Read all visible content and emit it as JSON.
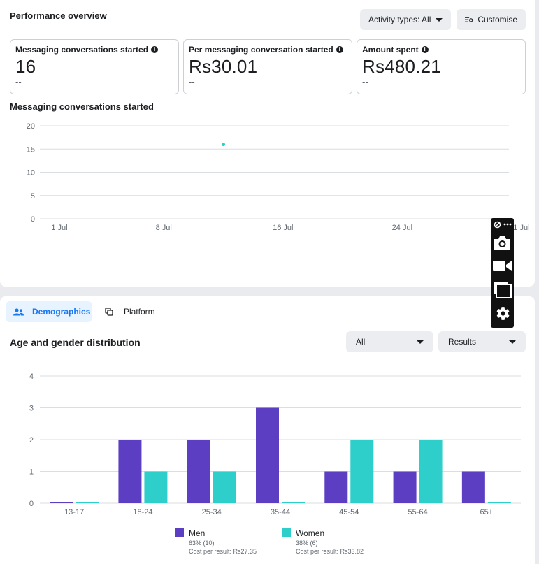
{
  "performance": {
    "title": "Performance overview",
    "activity_label": "Activity types: All",
    "customise_label": "Customise",
    "metrics": [
      {
        "label": "Messaging conversations started",
        "value": "16",
        "sub": "--"
      },
      {
        "label": "Per messaging conversation started",
        "value": "Rs30.01",
        "sub": "--"
      },
      {
        "label": "Amount spent",
        "value": "Rs480.21",
        "sub": "--"
      }
    ]
  },
  "line_chart": {
    "title": "Messaging conversations started",
    "y_ticks": [
      "20",
      "15",
      "10",
      "5",
      "0"
    ],
    "x_ticks": [
      "1 Jul",
      "8 Jul",
      "16 Jul",
      "24 Jul",
      "1 Jul"
    ]
  },
  "tabs": {
    "demographics": "Demographics",
    "platform": "Platform"
  },
  "demographics": {
    "title": "Age and gender distribution",
    "filter_all": "All",
    "filter_results": "Results"
  },
  "legend": {
    "men_label": "Men",
    "men_pct": "63% (10)",
    "men_cost": "Cost per result: Rs27.35",
    "women_label": "Women",
    "women_pct": "38% (6)",
    "women_cost": "Cost per result: Rs33.82"
  },
  "colors": {
    "men": "#5c3ec2",
    "women": "#2ecfcb",
    "accent": "#1877f2",
    "tab_active_bg": "#e7f3ff"
  },
  "icons": [
    "info-icon",
    "caret-down-icon",
    "filter-settings-icon",
    "people-icon",
    "platform-icon",
    "pin-icon",
    "more-icon",
    "camera-icon",
    "video-icon",
    "windows-icon",
    "gear-icon"
  ],
  "chart_data": [
    {
      "type": "scatter",
      "title": "Messaging conversations started",
      "x_ticks": [
        "1 Jul",
        "8 Jul",
        "16 Jul",
        "24 Jul",
        "1 Jul"
      ],
      "ylim": [
        0,
        20
      ],
      "y_ticks": [
        0,
        5,
        10,
        15,
        20
      ],
      "grid": true,
      "series": [
        {
          "points": [
            {
              "x": "12 Jul",
              "y": 16
            }
          ]
        }
      ]
    },
    {
      "type": "bar",
      "title": "Age and gender distribution",
      "categories": [
        "13-17",
        "18-24",
        "25-34",
        "35-44",
        "45-54",
        "55-64",
        "65+"
      ],
      "ylim": [
        0,
        4
      ],
      "y_ticks": [
        0,
        1,
        2,
        3,
        4
      ],
      "grid": true,
      "legend": "bottom",
      "series": [
        {
          "name": "Men",
          "values": [
            0,
            2,
            2,
            3,
            1,
            1,
            1
          ]
        },
        {
          "name": "Women",
          "values": [
            0,
            1,
            1,
            0,
            2,
            2,
            0
          ]
        }
      ]
    }
  ]
}
